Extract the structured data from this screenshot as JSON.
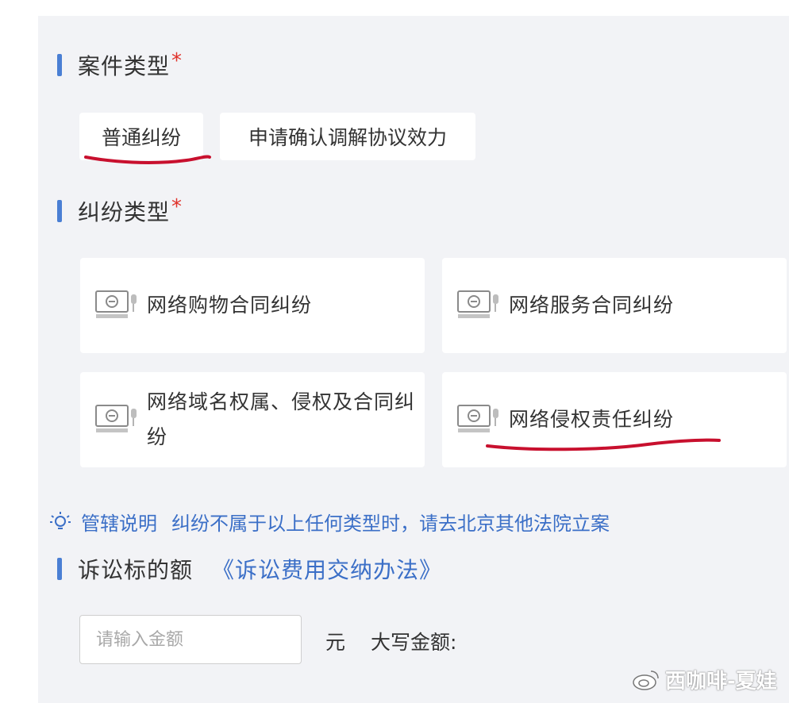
{
  "case_type": {
    "title": "案件类型",
    "required_mark": "*",
    "options": [
      "普通纠纷",
      "申请确认调解协议效力"
    ]
  },
  "dispute_type": {
    "title": "纠纷类型",
    "required_mark": "*",
    "options": [
      "网络购物合同纠纷",
      "网络服务合同纠纷",
      "网络域名权属、侵权及合同纠纷",
      "网络侵权责任纠纷"
    ]
  },
  "jurisdiction": {
    "label": "管辖说明",
    "text": "纠纷不属于以上任何类型时，请去北京其他法院立案"
  },
  "amount": {
    "title": "诉讼标的额",
    "link": "《诉讼费用交纳办法》",
    "placeholder": "请输入金额",
    "unit": "元",
    "uppercase_label": "大写金额:"
  },
  "watermark": {
    "text": "西咖啡-夏娃"
  },
  "colors": {
    "accent": "#3b6fc7",
    "bar": "#4a7fd4",
    "required": "#e0322b",
    "annotation_underline": "#c8102e"
  },
  "icons": {
    "card_icon": "computer-court-icon",
    "hint_icon": "lightbulb-icon",
    "watermark_icon": "weibo-icon"
  }
}
